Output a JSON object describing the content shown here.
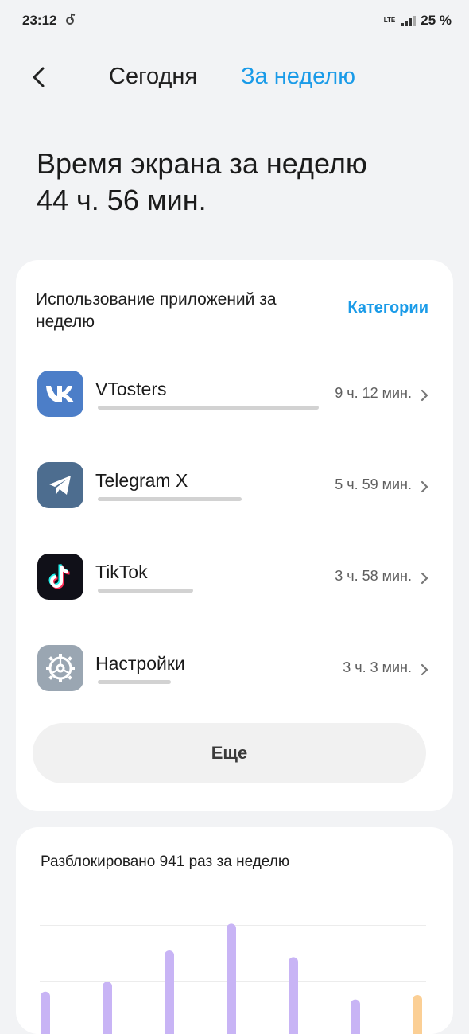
{
  "status_bar": {
    "time": "23:12",
    "network": "LTE",
    "battery": "25 %"
  },
  "nav": {
    "tab_today": "Сегодня",
    "tab_week": "За неделю"
  },
  "headline": {
    "line1": "Время экрана за неделю",
    "line2": "44 ч. 56 мин."
  },
  "apps_card": {
    "title": "Использование приложений за неделю",
    "categories_link": "Категории",
    "apps": [
      {
        "name": "VTosters",
        "time": "9 ч. 12 мин.",
        "share": 1.0,
        "icon": "vk-icon"
      },
      {
        "name": "Telegram X",
        "time": "5 ч. 59 мин.",
        "share": 0.65,
        "icon": "telegram-icon"
      },
      {
        "name": "TikTok",
        "time": "3 ч. 58 мин.",
        "share": 0.43,
        "icon": "tiktok-icon"
      },
      {
        "name": "Настройки",
        "time": "3 ч. 3 мин.",
        "share": 0.33,
        "icon": "settings-gear-icon"
      }
    ],
    "more_button": "Еще"
  },
  "unlock_card": {
    "title": "Разблокировано 941 раз за неделю"
  },
  "chart_data": {
    "type": "bar",
    "title": "Разблокировано 941 раз за неделю",
    "values": [
      38,
      47,
      75,
      99,
      69,
      31,
      35
    ],
    "colors": [
      "#c8b4f5",
      "#c8b4f5",
      "#c8b4f5",
      "#c8b4f5",
      "#c8b4f5",
      "#c8b4f5",
      "#fbcf95"
    ],
    "note": "bars partially visible; values estimated relative scale"
  }
}
